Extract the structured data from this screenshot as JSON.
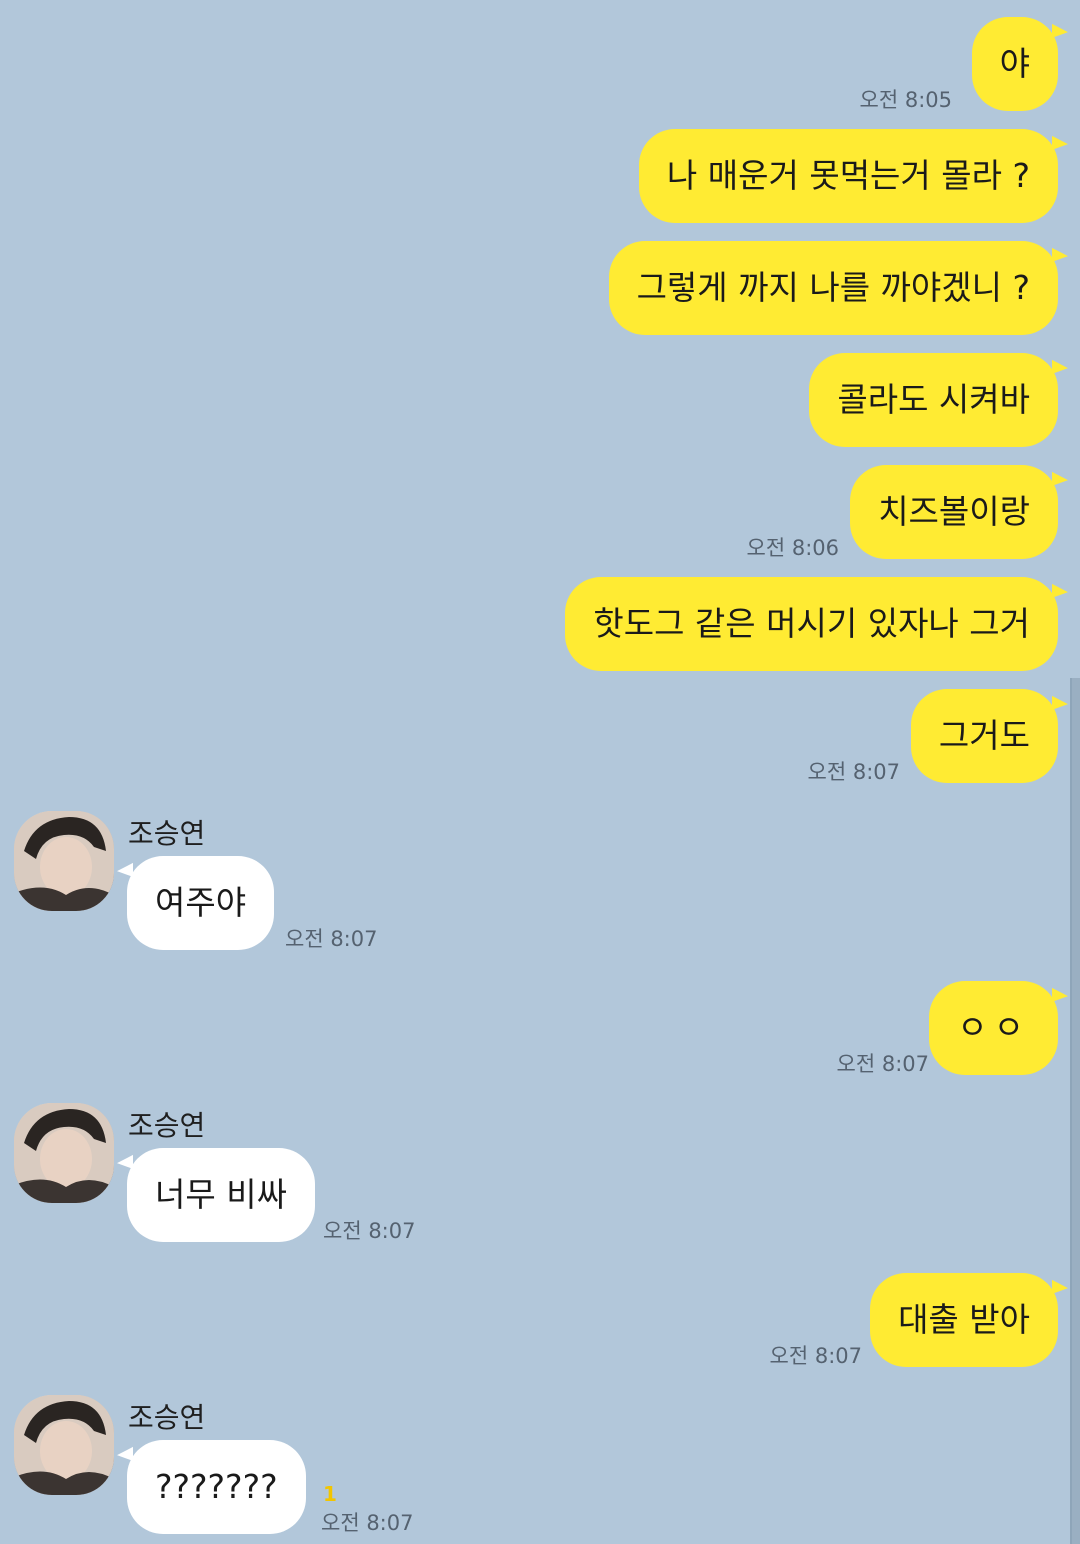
{
  "chat": {
    "contact_name": "조승연",
    "messages": [
      {
        "id": "m1",
        "sender": "me",
        "text": "야",
        "time": "오전 8:05"
      },
      {
        "id": "m2",
        "sender": "me",
        "text": "나 매운거 못먹는거 몰라 ?"
      },
      {
        "id": "m3",
        "sender": "me",
        "text": "그렇게 까지 나를 까야겠니 ?"
      },
      {
        "id": "m4",
        "sender": "me",
        "text": "콜라도 시켜바"
      },
      {
        "id": "m5",
        "sender": "me",
        "text": "치즈볼이랑",
        "time": "오전 8:06"
      },
      {
        "id": "m6",
        "sender": "me",
        "text": "핫도그 같은 머시기 있자나 그거"
      },
      {
        "id": "m7",
        "sender": "me",
        "text": "그거도",
        "time": "오전 8:07"
      },
      {
        "id": "m8",
        "sender": "them",
        "name": "조승연",
        "text": "여주야",
        "time": "오전 8:07"
      },
      {
        "id": "m9",
        "sender": "me",
        "text": "ㅇㅇ",
        "time": "오전 8:07"
      },
      {
        "id": "m10",
        "sender": "them",
        "name": "조승연",
        "text": "너무 비싸",
        "time": "오전 8:07"
      },
      {
        "id": "m11",
        "sender": "me",
        "text": "대출 받아",
        "time": "오전 8:07"
      },
      {
        "id": "m12",
        "sender": "them",
        "name": "조승연",
        "text": "???????",
        "time": "오전 8:07",
        "unread": "1"
      }
    ]
  },
  "colors": {
    "background": "#b2c7da",
    "my_bubble": "#ffeb33",
    "their_bubble": "#ffffff",
    "unread": "#f2c500"
  },
  "icons": {
    "avatar": "profile-photo"
  }
}
